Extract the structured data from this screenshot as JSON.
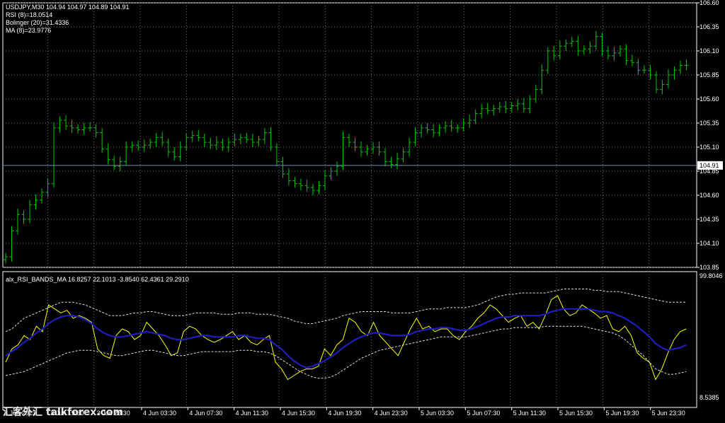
{
  "chart_data": [
    {
      "type": "candlestick",
      "symbol_line": "USDJPY,M30  104.94 104.97 104.89 104.91",
      "indicator_lines": [
        "RSI (8)=18.0514",
        "Bolinger (20)=31.4336",
        "MA (8)=23.9776"
      ],
      "ylim": [
        103.85,
        106.6
      ],
      "y_ticks": [
        "106.60",
        "106.35",
        "106.10",
        "105.85",
        "105.60",
        "105.35",
        "105.10",
        "104.85",
        "104.60",
        "104.35",
        "104.10",
        "103.85"
      ],
      "current_price": "104.91",
      "close": [
        103.96,
        104.23,
        104.4,
        104.35,
        104.5,
        104.55,
        104.63,
        104.72,
        105.3,
        105.38,
        105.32,
        105.3,
        105.28,
        105.3,
        105.3,
        105.25,
        105.08,
        104.97,
        104.9,
        104.95,
        105.1,
        105.12,
        105.1,
        105.12,
        105.15,
        105.2,
        105.15,
        105.05,
        105.0,
        105.1,
        105.2,
        105.22,
        105.2,
        105.15,
        105.12,
        105.15,
        105.1,
        105.15,
        105.18,
        105.2,
        105.18,
        105.15,
        105.18,
        105.25,
        105.1,
        104.95,
        104.82,
        104.75,
        104.72,
        104.7,
        104.68,
        104.65,
        104.7,
        104.8,
        104.85,
        104.9,
        105.2,
        105.15,
        105.1,
        105.05,
        105.08,
        105.1,
        105.05,
        104.95,
        104.92,
        104.98,
        105.05,
        105.15,
        105.25,
        105.3,
        105.28,
        105.25,
        105.3,
        105.32,
        105.3,
        105.3,
        105.35,
        105.38,
        105.45,
        105.5,
        105.48,
        105.5,
        105.52,
        105.5,
        105.53,
        105.55,
        105.5,
        105.6,
        105.7,
        105.9,
        106.1,
        106.05,
        106.15,
        106.18,
        106.2,
        106.1,
        106.12,
        106.15,
        106.25,
        106.1,
        106.05,
        106.08,
        106.12,
        106.0,
        105.98,
        105.9,
        105.9,
        105.85,
        105.7,
        105.75,
        105.85,
        105.9,
        105.95,
        105.95
      ]
    },
    {
      "type": "line",
      "header": "alx_RSI_BANDS_MA 16.8257 22.1013 -3.8540 62.4361 29.2910",
      "ylim": [
        8.5385,
        99.8046
      ],
      "y_ticks": [
        "99.8046",
        "8.5385"
      ],
      "series": [
        {
          "name": "RSI",
          "color": "#ffff00",
          "values": [
            35,
            45,
            48,
            55,
            52,
            62,
            58,
            78,
            75,
            72,
            74,
            68,
            70,
            68,
            65,
            45,
            40,
            38,
            55,
            60,
            58,
            52,
            55,
            65,
            60,
            55,
            48,
            40,
            42,
            58,
            62,
            60,
            55,
            52,
            50,
            52,
            55,
            58,
            52,
            55,
            50,
            48,
            52,
            55,
            35,
            30,
            22,
            25,
            28,
            30,
            30,
            32,
            45,
            40,
            48,
            52,
            68,
            65,
            58,
            55,
            65,
            55,
            50,
            45,
            40,
            50,
            60,
            68,
            60,
            62,
            58,
            60,
            60,
            55,
            52,
            58,
            62,
            68,
            72,
            78,
            75,
            70,
            65,
            68,
            70,
            62,
            65,
            60,
            70,
            82,
            85,
            75,
            70,
            72,
            78,
            75,
            72,
            68,
            70,
            60,
            58,
            62,
            55,
            42,
            38,
            35,
            22,
            30,
            42,
            52,
            58,
            60
          ]
        },
        {
          "name": "RSI MA",
          "color": "#1e1ebe",
          "values": [
            40,
            43,
            46,
            50,
            53,
            57,
            60,
            64,
            67,
            69,
            70,
            70,
            69,
            67,
            64,
            60,
            57,
            55,
            54,
            54,
            55,
            56,
            57,
            58,
            57,
            56,
            55,
            53,
            52,
            52,
            53,
            54,
            55,
            55,
            54,
            54,
            54,
            54,
            55,
            55,
            54,
            53,
            53,
            52,
            48,
            45,
            40,
            36,
            33,
            31,
            32,
            34,
            36,
            39,
            42,
            46,
            49,
            52,
            54,
            56,
            57,
            57,
            56,
            55,
            55,
            55,
            56,
            58,
            59,
            60,
            60,
            61,
            61,
            60,
            59,
            59,
            60,
            62,
            64,
            66,
            68,
            69,
            69,
            70,
            70,
            70,
            70,
            70,
            71,
            73,
            74,
            75,
            75,
            75,
            75,
            75,
            74,
            73,
            73,
            72,
            70,
            68,
            65,
            62,
            58,
            54,
            49,
            46,
            44,
            45,
            46,
            48
          ]
        },
        {
          "name": "Upper Band",
          "color": "#dddddd",
          "values": [
            58,
            60,
            64,
            68,
            70,
            72,
            74,
            76,
            78,
            80,
            80,
            80,
            79,
            78,
            76,
            74,
            72,
            70,
            70,
            70,
            71,
            72,
            72,
            73,
            73,
            72,
            71,
            70,
            70,
            70,
            71,
            72,
            72,
            72,
            72,
            71,
            71,
            71,
            72,
            72,
            72,
            71,
            71,
            71,
            70,
            69,
            68,
            66,
            65,
            64,
            64,
            65,
            66,
            67,
            68,
            70,
            71,
            72,
            73,
            73,
            73,
            73,
            73,
            72,
            72,
            72,
            72,
            73,
            74,
            75,
            75,
            75,
            76,
            76,
            76,
            76,
            77,
            78,
            80,
            82,
            84,
            85,
            86,
            86,
            87,
            87,
            87,
            87,
            87,
            88,
            89,
            90,
            90,
            90,
            90,
            90,
            89,
            89,
            88,
            88,
            88,
            87,
            86,
            85,
            84,
            83,
            82,
            81,
            80,
            80,
            80,
            80
          ]
        },
        {
          "name": "Lower Band",
          "color": "#dddddd",
          "values": [
            25,
            26,
            27,
            28,
            30,
            32,
            34,
            36,
            38,
            40,
            42,
            43,
            44,
            44,
            44,
            43,
            42,
            41,
            40,
            40,
            41,
            42,
            43,
            44,
            44,
            43,
            42,
            41,
            40,
            40,
            41,
            42,
            43,
            43,
            43,
            43,
            43,
            43,
            44,
            44,
            44,
            43,
            43,
            42,
            40,
            37,
            34,
            31,
            28,
            26,
            24,
            23,
            23,
            24,
            26,
            29,
            32,
            35,
            38,
            40,
            42,
            44,
            45,
            46,
            47,
            48,
            49,
            50,
            51,
            52,
            53,
            54,
            54,
            54,
            54,
            54,
            55,
            56,
            57,
            58,
            59,
            60,
            60,
            61,
            61,
            61,
            61,
            61,
            62,
            62,
            62,
            62,
            62,
            62,
            62,
            61,
            60,
            59,
            58,
            57,
            55,
            52,
            48,
            44,
            40,
            35,
            30,
            28,
            26,
            26,
            27,
            28
          ]
        }
      ]
    }
  ],
  "time_axis": [
    "3 Jun 2013",
    "3 Jun 19:30",
    "3 Jun 23:30",
    "4 Jun 03:30",
    "4 Jun 07:30",
    "4 Jun 11:30",
    "4 Jun 15:30",
    "4 Jun 19:30",
    "4 Jun 23:30",
    "5 Jun 03:30",
    "5 Jun 07:30",
    "5 Jun 11:30",
    "5 Jun 15:30",
    "5 Jun 19:30",
    "5 Jun 23:30"
  ],
  "watermark": "汇客外汇 talkforex.com",
  "colors": {
    "bar": "#00c800",
    "grid": "#777777",
    "axis": "#ffffff",
    "price_line": "#6a8fbf",
    "price_box": "#ffffff"
  }
}
